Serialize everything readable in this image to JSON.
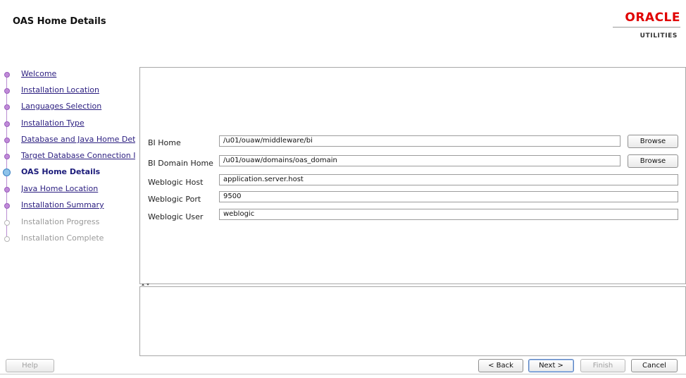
{
  "header": {
    "title": "OAS Home Details",
    "logo_text": "ORACLE",
    "logo_sub": "UTILITIES",
    "logo_color": "#e00000"
  },
  "steps": [
    {
      "label": "Welcome",
      "state": "done"
    },
    {
      "label": "Installation Location",
      "state": "done"
    },
    {
      "label": "Languages Selection",
      "state": "done"
    },
    {
      "label": "Installation Type",
      "state": "done"
    },
    {
      "label": "Database and Java Home Det",
      "state": "done"
    },
    {
      "label": "Target Database Connection I",
      "state": "done"
    },
    {
      "label": "OAS Home Details",
      "state": "current"
    },
    {
      "label": "Java Home Location",
      "state": "done"
    },
    {
      "label": "Installation Summary",
      "state": "done"
    },
    {
      "label": "Installation Progress",
      "state": "pending"
    },
    {
      "label": "Installation Complete",
      "state": "pending"
    }
  ],
  "form": {
    "bi_home": {
      "label": "BI Home",
      "value": "/u01/ouaw/middleware/bi"
    },
    "bi_domain_home": {
      "label": "BI Domain Home",
      "value": "/u01/ouaw/domains/oas_domain"
    },
    "weblogic_host": {
      "label": "Weblogic Host",
      "value": "application.server.host"
    },
    "weblogic_port": {
      "label": "Weblogic Port",
      "value": "9500"
    },
    "weblogic_user": {
      "label": "Weblogic User",
      "value": "weblogic"
    },
    "browse_label": "Browse"
  },
  "footer": {
    "help": "Help",
    "back": "< Back",
    "next": "Next >",
    "finish": "Finish",
    "cancel": "Cancel"
  }
}
